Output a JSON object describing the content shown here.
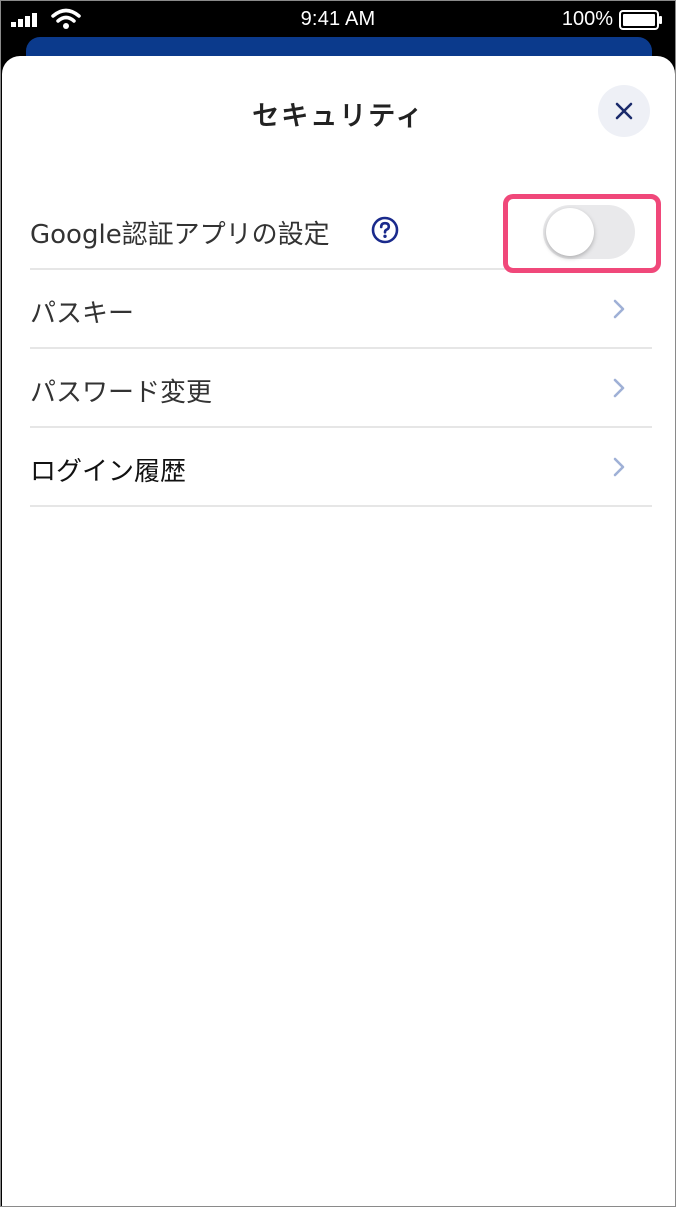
{
  "status_bar": {
    "time": "9:41 AM",
    "battery": "100%"
  },
  "header": {
    "title": "セキュリティ",
    "close_icon": "close-icon"
  },
  "settings": {
    "items": [
      {
        "label": "Google認証アプリの設定",
        "control": "toggle",
        "toggle_on": false,
        "help_icon": "question-circle-icon"
      },
      {
        "label": "パスキー",
        "control": "chevron"
      },
      {
        "label": "パスワード変更",
        "control": "chevron"
      },
      {
        "label": "ログイン履歴",
        "control": "chevron"
      }
    ]
  },
  "colors": {
    "accent_navy": "#0b3a8c",
    "highlight_pink": "#f0487a",
    "chevron": "#9fb0d6",
    "toggle_off": "#e9e9eb"
  }
}
